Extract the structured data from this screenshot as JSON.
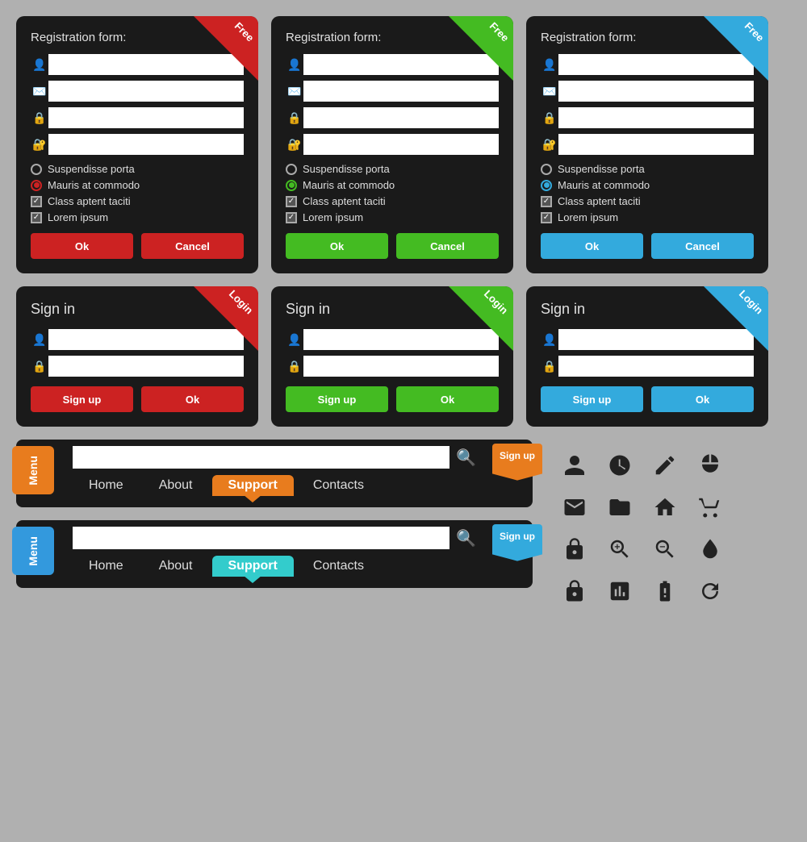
{
  "colors": {
    "red": "#cc2222",
    "green": "#44bb22",
    "blue": "#33aadd",
    "orange": "#e87c1e",
    "cyan": "#33cccc",
    "dark": "#1a1a1a"
  },
  "registration_forms": [
    {
      "id": "reg-red",
      "title": "Registration form:",
      "corner": "Free",
      "corner_color": "red",
      "ok_label": "Ok",
      "cancel_label": "Cancel",
      "btn_color": "red"
    },
    {
      "id": "reg-green",
      "title": "Registration form:",
      "corner": "Free",
      "corner_color": "green",
      "ok_label": "Ok",
      "cancel_label": "Cancel",
      "btn_color": "green"
    },
    {
      "id": "reg-blue",
      "title": "Registration form:",
      "corner": "Free",
      "corner_color": "blue",
      "ok_label": "Ok",
      "cancel_label": "Cancel",
      "btn_color": "blue"
    }
  ],
  "login_forms": [
    {
      "id": "login-red",
      "title": "Sign in",
      "corner": "Login",
      "corner_color": "red",
      "signup_label": "Sign up",
      "ok_label": "Ok",
      "btn_color": "red"
    },
    {
      "id": "login-green",
      "title": "Sign in",
      "corner": "Login",
      "corner_color": "green",
      "signup_label": "Sign up",
      "ok_label": "Ok",
      "btn_color": "green"
    },
    {
      "id": "login-blue",
      "title": "Sign in",
      "corner": "Login",
      "corner_color": "blue",
      "signup_label": "Sign up",
      "ok_label": "Ok",
      "btn_color": "blue"
    }
  ],
  "options": [
    {
      "type": "radio",
      "label": "Suspendisse porta",
      "filled": false
    },
    {
      "type": "radio",
      "label": "Mauris at commodo",
      "filled": true
    },
    {
      "type": "checkbox",
      "label": "Class aptent taciti",
      "checked": true
    },
    {
      "type": "checkbox",
      "label": "Lorem ipsum",
      "checked": true
    }
  ],
  "nav_bars": [
    {
      "id": "nav-orange",
      "menu_label": "Menu",
      "menu_color": "orange",
      "links": [
        "Home",
        "About",
        "Support",
        "Contacts"
      ],
      "active_link": "Support",
      "active_color": "orange",
      "signup_label": "Sign up",
      "signup_color": "orange"
    },
    {
      "id": "nav-blue",
      "menu_label": "Menu",
      "menu_color": "blue",
      "links": [
        "Home",
        "About",
        "Support",
        "Contacts"
      ],
      "active_link": "Support",
      "active_color": "cyan",
      "signup_label": "Sign up",
      "signup_color": "blue"
    }
  ],
  "icons": [
    "👤",
    "🕐",
    "✏️",
    "🖱️",
    "✉️",
    "📁",
    "🏠",
    "🛒",
    "🔒",
    "🔍",
    "🔎",
    "💧",
    "🔐",
    "📊",
    "🔋",
    "🔄"
  ]
}
